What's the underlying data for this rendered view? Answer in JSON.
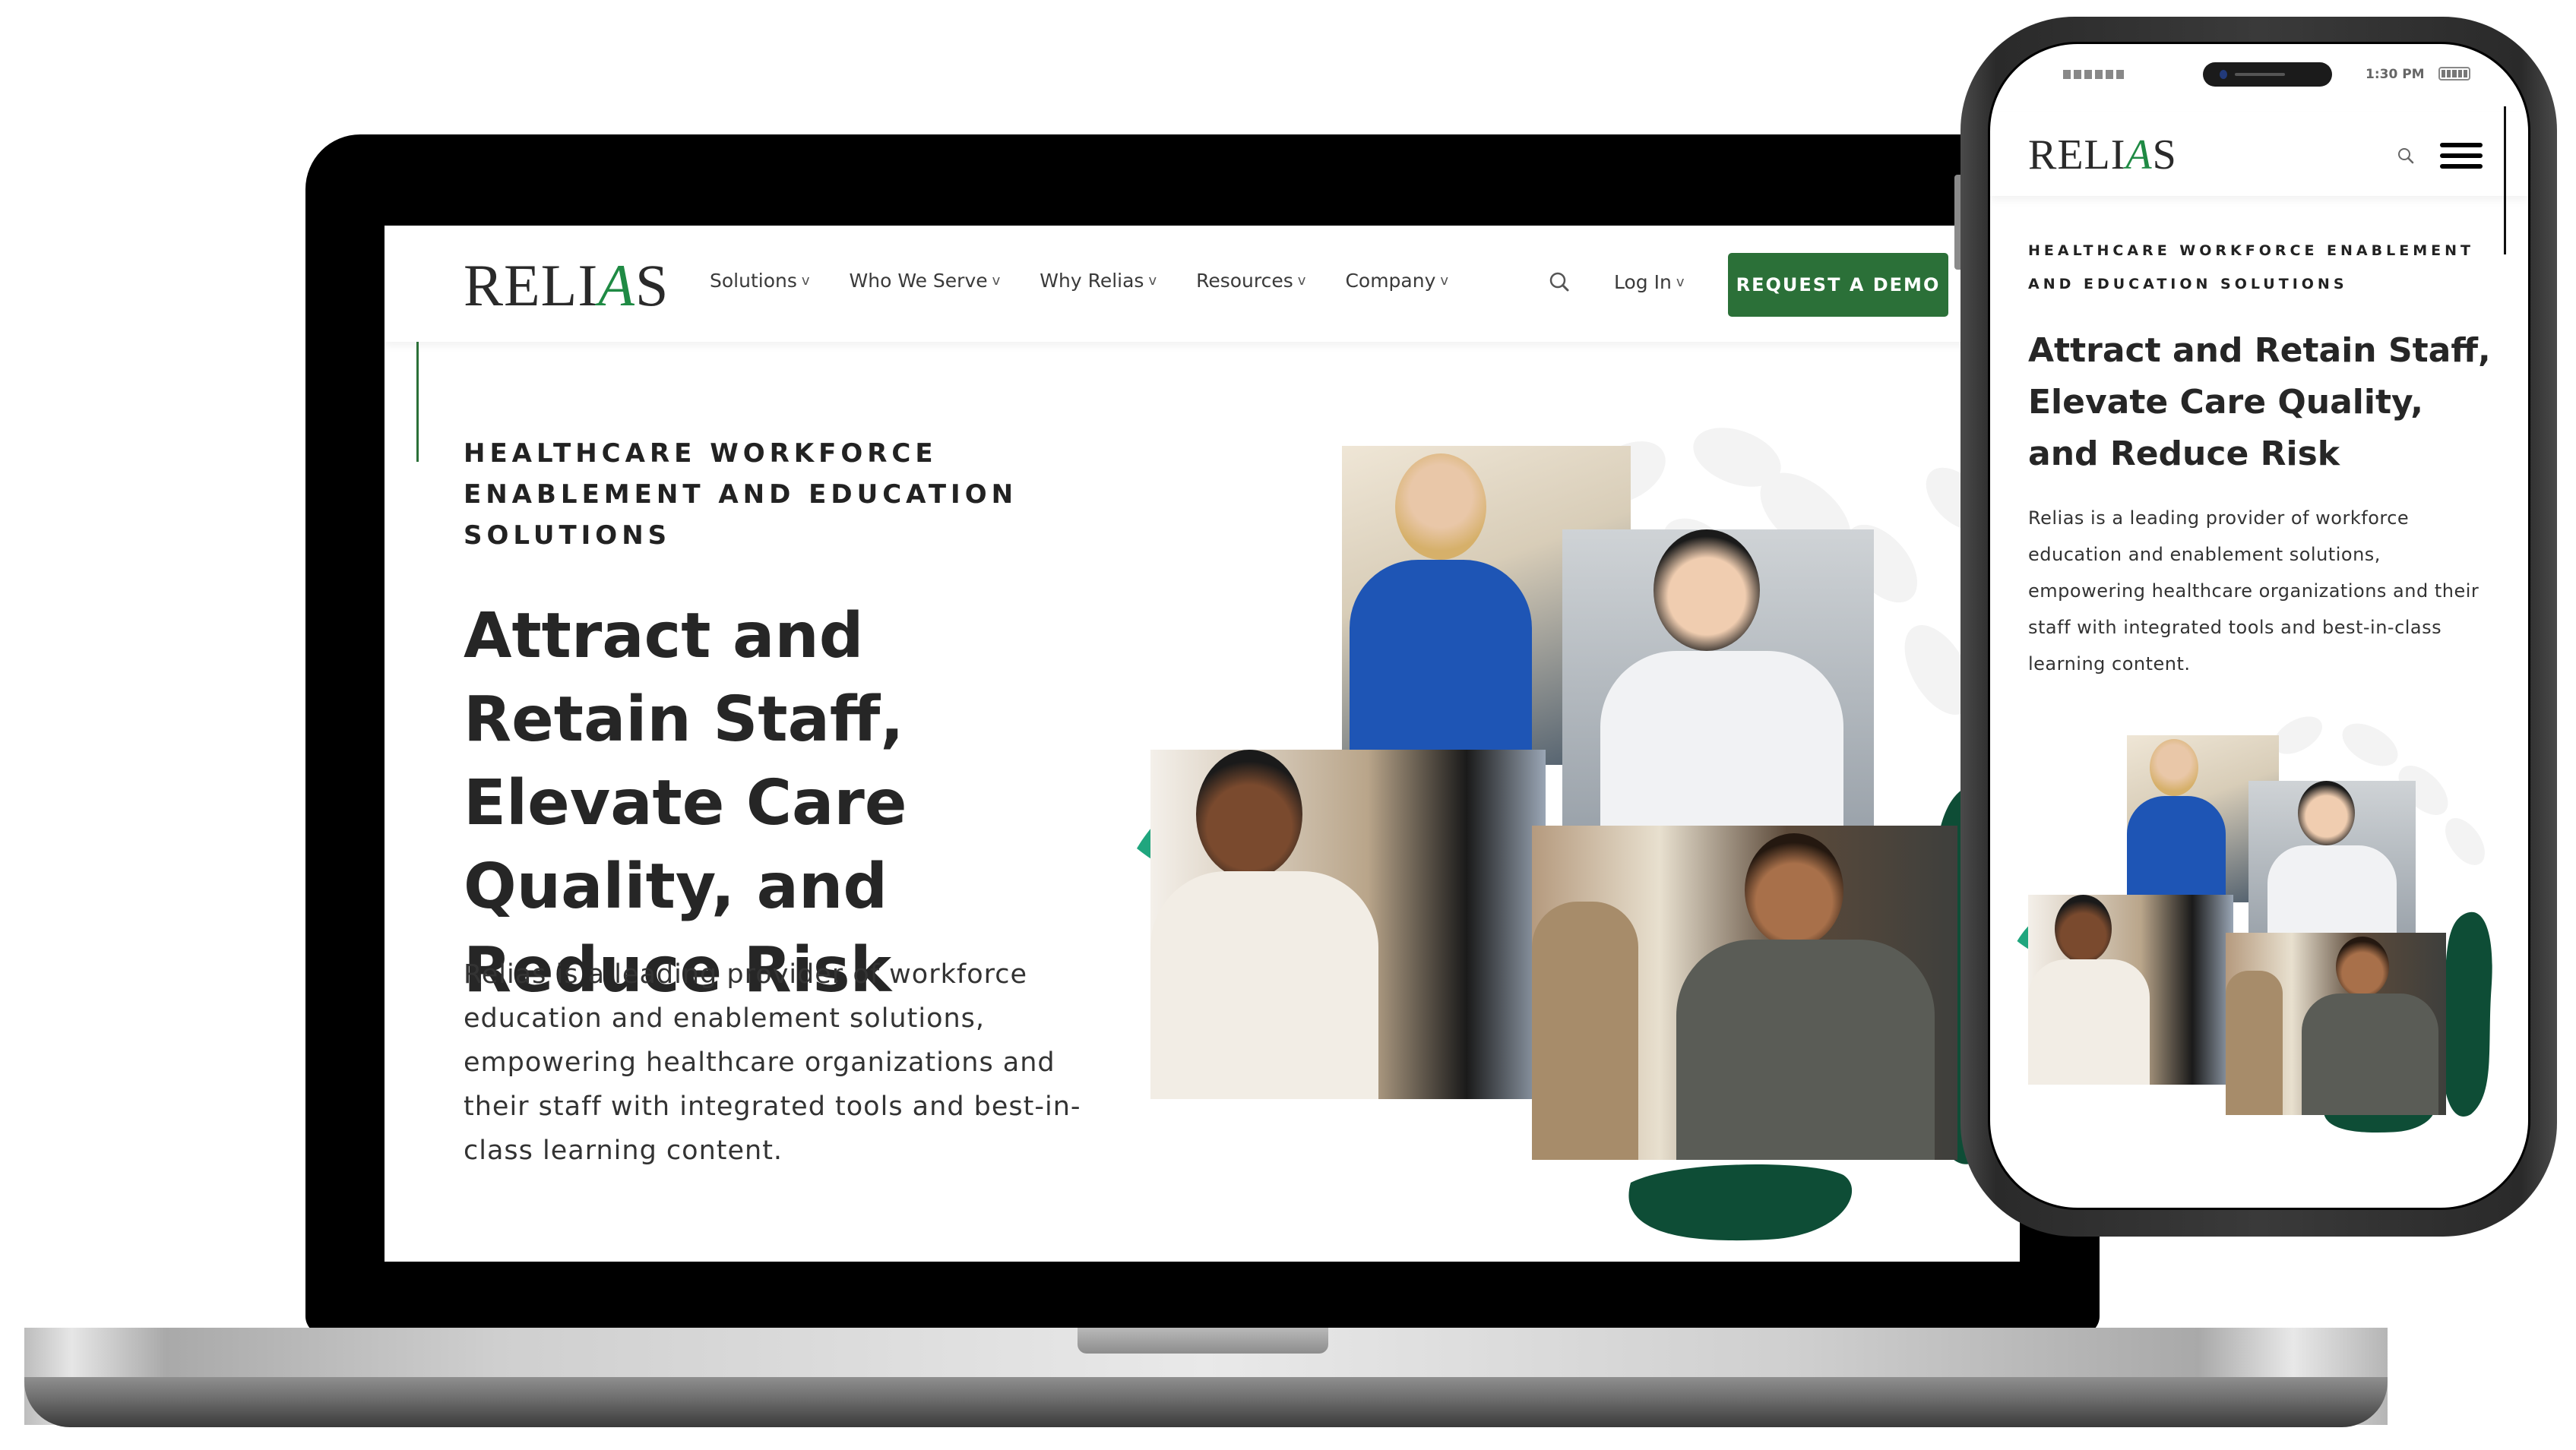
{
  "brand": {
    "name_part1": "RELI",
    "name_accent": "A",
    "name_part2": "S",
    "accent_color": "#1f8a44",
    "button_color": "#2b7038",
    "blob_teal": "#20a67e",
    "blob_dark": "#0e4d36"
  },
  "desktop": {
    "nav": {
      "items": [
        {
          "label": "Solutions",
          "chevron": "v"
        },
        {
          "label": "Who We Serve",
          "chevron": "v"
        },
        {
          "label": "Why Relias",
          "chevron": "v"
        },
        {
          "label": "Resources",
          "chevron": "v"
        },
        {
          "label": "Company",
          "chevron": "v"
        }
      ],
      "search_icon": "search-icon",
      "login_label": "Log In",
      "login_chevron": "v",
      "cta_label": "REQUEST A DEMO"
    },
    "hero": {
      "eyebrow": "HEALTHCARE WORKFORCE ENABLEMENT AND EDUCATION SOLUTIONS",
      "title": "Attract and Retain Staff, Elevate Care Quality, and Reduce Risk",
      "body": "Relias is a leading provider of workforce education and enablement solutions, empowering healthcare organizations and their staff with integrated tools and best-in-class learning content."
    },
    "collage": {
      "photos": [
        {
          "subject": "nurse in blue scrubs with stethoscope"
        },
        {
          "subject": "doctor in white coat at laptop"
        },
        {
          "subject": "smiling woman with clipboard"
        },
        {
          "subject": "caregiver with tablet and elderly man"
        }
      ]
    }
  },
  "mobile": {
    "status_bar": {
      "time": "1:30 PM",
      "battery_icon": "battery-icon",
      "signal_icon": "signal-icon"
    },
    "nav": {
      "search_icon": "search-icon",
      "menu_icon": "hamburger-menu-icon"
    },
    "hero": {
      "eyebrow": "HEALTHCARE WORKFORCE ENABLEMENT AND EDUCATION SOLUTIONS",
      "title": "Attract and Retain Staff, Elevate Care Quality, and Reduce Risk",
      "body": "Relias is a leading provider of workforce education and enablement solutions, empowering healthcare organizations and their staff with integrated tools and best-in-class learning content."
    }
  }
}
